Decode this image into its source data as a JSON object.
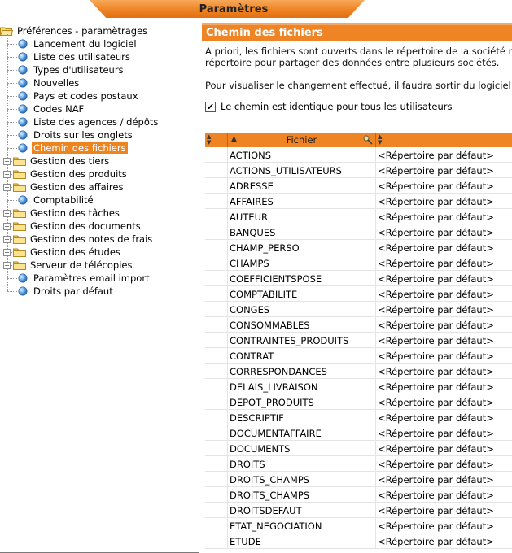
{
  "window": {
    "title": "Paramètres"
  },
  "tree": {
    "root_label": "Préférences - paramètrages",
    "items": [
      {
        "label": "Lancement du logiciel",
        "kind": "leaf",
        "selected": false
      },
      {
        "label": "Liste des utilisateurs",
        "kind": "leaf",
        "selected": false
      },
      {
        "label": "Types d'utilisateurs",
        "kind": "leaf",
        "selected": false
      },
      {
        "label": "Nouvelles",
        "kind": "leaf",
        "selected": false
      },
      {
        "label": "Pays et codes postaux",
        "kind": "leaf",
        "selected": false
      },
      {
        "label": "Codes NAF",
        "kind": "leaf",
        "selected": false
      },
      {
        "label": "Liste des agences / dépôts",
        "kind": "leaf",
        "selected": false
      },
      {
        "label": "Droits sur les onglets",
        "kind": "leaf",
        "selected": false
      },
      {
        "label": "Chemin des fichiers",
        "kind": "leaf",
        "selected": true
      },
      {
        "label": "Gestion des tiers",
        "kind": "folder",
        "selected": false
      },
      {
        "label": "Gestion des produits",
        "kind": "folder",
        "selected": false
      },
      {
        "label": "Gestion des affaires",
        "kind": "folder",
        "selected": false
      },
      {
        "label": "Comptabilité",
        "kind": "leaf",
        "selected": false
      },
      {
        "label": "Gestion des tâches",
        "kind": "folder",
        "selected": false
      },
      {
        "label": "Gestion des documents",
        "kind": "folder",
        "selected": false
      },
      {
        "label": "Gestion des notes de frais",
        "kind": "folder",
        "selected": false
      },
      {
        "label": "Gestion des études",
        "kind": "folder",
        "selected": false
      },
      {
        "label": "Serveur de télécopies",
        "kind": "folder",
        "selected": false
      },
      {
        "label": "Paramètres email import",
        "kind": "leaf",
        "selected": false
      },
      {
        "label": "Droits par défaut",
        "kind": "leaf",
        "selected": false
      }
    ]
  },
  "panel": {
    "title": "Chemin des fichiers",
    "desc_line1": "A priori, les fichiers sont ouverts dans le répertoire de la société n",
    "desc_line2": "répertoire pour partager des données entre plusieurs sociétés.",
    "desc_line3": "Pour visualiser le changement effectué, il faudra sortir du logiciel",
    "checkbox_label": "Le chemin est identique pour tous les utilisateurs",
    "checkbox_checked": true,
    "checkbox_mark": "✔"
  },
  "grid": {
    "col_fichier": "Fichier",
    "rows": [
      {
        "fichier": "ACTIONS",
        "repertoire": "<Répertoire par défaut>"
      },
      {
        "fichier": "ACTIONS_UTILISATEURS",
        "repertoire": "<Répertoire par défaut>"
      },
      {
        "fichier": "ADRESSE",
        "repertoire": "<Répertoire par défaut>"
      },
      {
        "fichier": "AFFAIRES",
        "repertoire": "<Répertoire par défaut>"
      },
      {
        "fichier": "AUTEUR",
        "repertoire": "<Répertoire par défaut>"
      },
      {
        "fichier": "BANQUES",
        "repertoire": "<Répertoire par défaut>"
      },
      {
        "fichier": "CHAMP_PERSO",
        "repertoire": "<Répertoire par défaut>"
      },
      {
        "fichier": "CHAMPS",
        "repertoire": "<Répertoire par défaut>"
      },
      {
        "fichier": "COEFFICIENTSPOSE",
        "repertoire": "<Répertoire par défaut>"
      },
      {
        "fichier": "COMPTABILITE",
        "repertoire": "<Répertoire par défaut>"
      },
      {
        "fichier": "CONGES",
        "repertoire": "<Répertoire par défaut>"
      },
      {
        "fichier": "CONSOMMABLES",
        "repertoire": "<Répertoire par défaut>"
      },
      {
        "fichier": "CONTRAINTES_PRODUITS",
        "repertoire": "<Répertoire par défaut>"
      },
      {
        "fichier": "CONTRAT",
        "repertoire": "<Répertoire par défaut>"
      },
      {
        "fichier": "CORRESPONDANCES",
        "repertoire": "<Répertoire par défaut>"
      },
      {
        "fichier": "DELAIS_LIVRAISON",
        "repertoire": "<Répertoire par défaut>"
      },
      {
        "fichier": "DEPOT_PRODUITS",
        "repertoire": "<Répertoire par défaut>"
      },
      {
        "fichier": "DESCRIPTIF",
        "repertoire": "<Répertoire par défaut>"
      },
      {
        "fichier": "DOCUMENTAFFAIRE",
        "repertoire": "<Répertoire par défaut>"
      },
      {
        "fichier": "DOCUMENTS",
        "repertoire": "<Répertoire par défaut>"
      },
      {
        "fichier": "DROITS",
        "repertoire": "<Répertoire par défaut>"
      },
      {
        "fichier": "DROITS_CHAMPS",
        "repertoire": "<Répertoire par défaut>"
      },
      {
        "fichier": "DROITS_CHAMPS",
        "repertoire": "<Répertoire par défaut>"
      },
      {
        "fichier": "DROITSDEFAUT",
        "repertoire": "<Répertoire par défaut>"
      },
      {
        "fichier": "ETAT_NEGOCIATION",
        "repertoire": "<Répertoire par défaut>"
      },
      {
        "fichier": "ETUDE",
        "repertoire": "<Répertoire par défaut>"
      }
    ]
  },
  "colors": {
    "accent": "#ee8424",
    "selection": "#ec8520"
  }
}
